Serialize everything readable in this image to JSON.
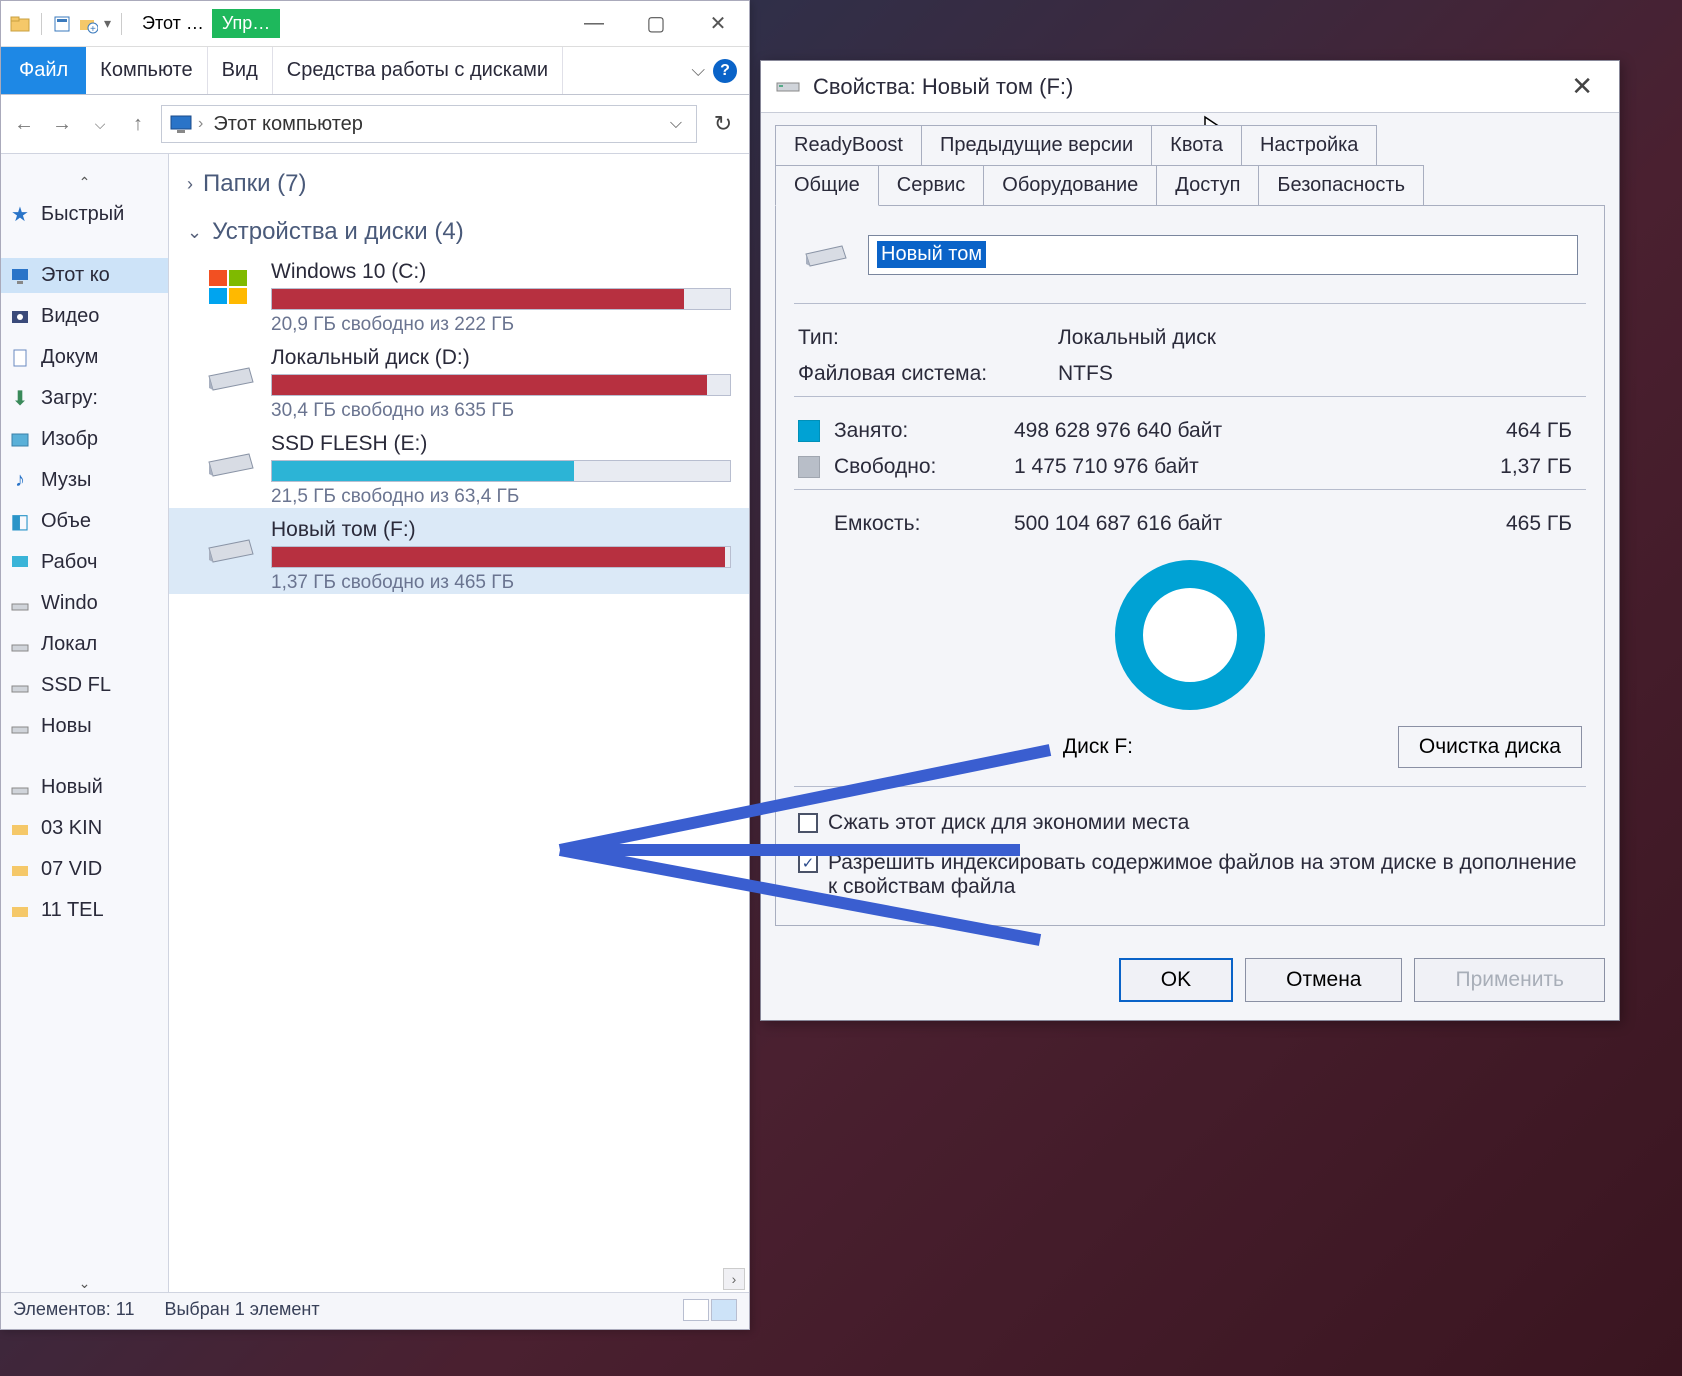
{
  "explorer": {
    "titlebar": {
      "title1": "Этот …",
      "title2": "Упр…"
    },
    "menu": {
      "file": "Файл",
      "computer": "Компьюте",
      "view": "Вид",
      "drive_tools": "Средства работы с дисками"
    },
    "address": "Этот компьютер",
    "sidebar": {
      "quick": "Быстрый",
      "this_pc": "Этот ко",
      "videos": "Видео",
      "documents": "Докум",
      "downloads": "Загру:",
      "pictures": "Изобр",
      "music": "Музы",
      "objects": "Объе",
      "desktop": "Рабоч",
      "windo": "Windo",
      "local": "Локал",
      "ssdfl": "SSD FL",
      "novyi": "Новы",
      "novyi2": "Новый",
      "kin": "03 KIN",
      "vid": "07 VID",
      "tel": "11 TEL"
    },
    "sections": {
      "folders": "Папки (7)",
      "devices": "Устройства и диски (4)"
    },
    "drives": [
      {
        "title": "Windows 10 (C:)",
        "sub": "20,9 ГБ свободно из 222 ГБ",
        "fill": 90,
        "color": "red",
        "icon": "win"
      },
      {
        "title": "Локальный диск (D:)",
        "sub": "30,4 ГБ свободно из 635 ГБ",
        "fill": 95,
        "color": "red",
        "icon": "hdd"
      },
      {
        "title": "SSD FLESH (E:)",
        "sub": "21,5 ГБ свободно из 63,4 ГБ",
        "fill": 66,
        "color": "blue",
        "icon": "hdd"
      },
      {
        "title": "Новый том (F:)",
        "sub": "1,37 ГБ свободно из 465 ГБ",
        "fill": 99,
        "color": "red",
        "icon": "hdd"
      }
    ],
    "status": {
      "items": "Элементов: 11",
      "selected": "Выбран 1 элемент"
    }
  },
  "props": {
    "title": "Свойства: Новый том (F:)",
    "tabs_row1": [
      "ReadyBoost",
      "Предыдущие версии",
      "Квота",
      "Настройка"
    ],
    "tabs_row2": [
      "Общие",
      "Сервис",
      "Оборудование",
      "Доступ",
      "Безопасность"
    ],
    "name": "Новый том",
    "type_label": "Тип:",
    "type_val": "Локальный диск",
    "fs_label": "Файловая система:",
    "fs_val": "NTFS",
    "used_label": "Занято:",
    "used_bytes": "498 628 976 640 байт",
    "used_h": "464 ГБ",
    "free_label": "Свободно:",
    "free_bytes": "1 475 710 976 байт",
    "free_h": "1,37 ГБ",
    "cap_label": "Емкость:",
    "cap_bytes": "500 104 687 616 байт",
    "cap_h": "465 ГБ",
    "disk_label": "Диск F:",
    "cleanup": "Очистка диска",
    "compress": "Сжать этот диск для экономии места",
    "index": "Разрешить индексировать содержимое файлов на этом диске в дополнение к свойствам файла",
    "ok": "OK",
    "cancel": "Отмена",
    "apply": "Применить"
  }
}
